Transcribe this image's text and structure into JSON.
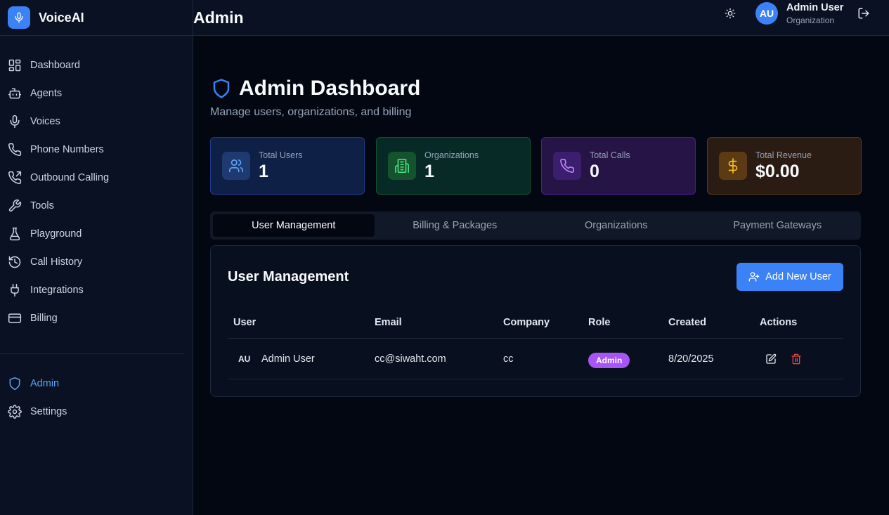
{
  "brand": {
    "name": "VoiceAI"
  },
  "sidebar": {
    "items": [
      {
        "label": "Dashboard",
        "icon": "layout-grid-icon"
      },
      {
        "label": "Agents",
        "icon": "bot-icon"
      },
      {
        "label": "Voices",
        "icon": "mic-icon"
      },
      {
        "label": "Phone Numbers",
        "icon": "phone-icon"
      },
      {
        "label": "Outbound Calling",
        "icon": "phone-outgoing-icon"
      },
      {
        "label": "Tools",
        "icon": "wrench-icon"
      },
      {
        "label": "Playground",
        "icon": "flask-icon"
      },
      {
        "label": "Call History",
        "icon": "history-icon"
      },
      {
        "label": "Integrations",
        "icon": "plug-icon"
      },
      {
        "label": "Billing",
        "icon": "credit-card-icon"
      }
    ],
    "bottom_items": [
      {
        "label": "Admin",
        "icon": "shield-icon",
        "active": true
      },
      {
        "label": "Settings",
        "icon": "gear-icon"
      }
    ]
  },
  "header": {
    "title": "Admin",
    "user": {
      "initials": "AU",
      "name": "Admin User",
      "org": "Organization"
    }
  },
  "page": {
    "title": "Admin Dashboard",
    "subtitle": "Manage users, organizations, and billing"
  },
  "stats": [
    {
      "label": "Total Users",
      "value": "1",
      "color": "#60a5fa"
    },
    {
      "label": "Organizations",
      "value": "1",
      "color": "#4ade80"
    },
    {
      "label": "Total Calls",
      "value": "0",
      "color": "#c084fc"
    },
    {
      "label": "Total Revenue",
      "value": "$0.00",
      "color": "#fbbf24"
    }
  ],
  "tabs": [
    {
      "label": "User Management",
      "active": true
    },
    {
      "label": "Billing & Packages"
    },
    {
      "label": "Organizations"
    },
    {
      "label": "Payment Gateways"
    }
  ],
  "users_card": {
    "title": "User Management",
    "add_button": "Add New User",
    "columns": [
      "User",
      "Email",
      "Company",
      "Role",
      "Created",
      "Actions"
    ],
    "rows": [
      {
        "initials": "AU",
        "name": "Admin User",
        "email": "cc@siwaht.com",
        "company": "cc",
        "role": "Admin",
        "created": "8/20/2025"
      }
    ]
  },
  "colors": {
    "accent": "#3b82f6",
    "role_badge": "#a855f7",
    "danger": "#ef4444"
  }
}
